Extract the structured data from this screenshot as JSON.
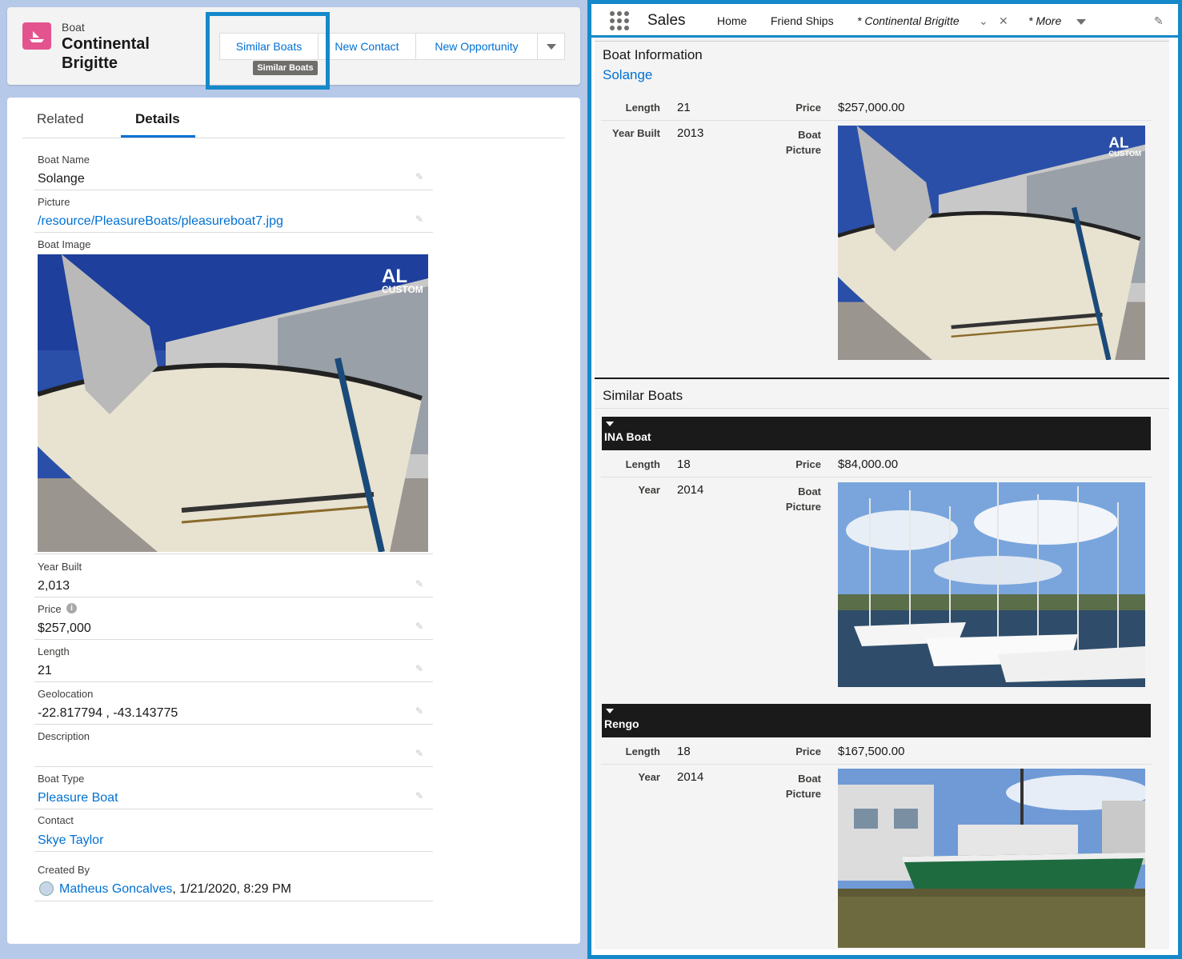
{
  "header": {
    "object_type": "Boat",
    "record_title": "Continental Brigitte",
    "actions": [
      "Similar Boats",
      "New Contact",
      "New Opportunity"
    ],
    "tooltip": "Similar Boats"
  },
  "tabs": [
    "Related",
    "Details"
  ],
  "fields": {
    "boat_name_label": "Boat Name",
    "boat_name": "Solange",
    "picture_label": "Picture",
    "picture": "/resource/PleasureBoats/pleasureboat7.jpg",
    "boat_image_label": "Boat Image",
    "year_built_label": "Year Built",
    "year_built": "2,013",
    "price_label": "Price",
    "price": "$257,000",
    "length_label": "Length",
    "length": "21",
    "geolocation_label": "Geolocation",
    "geolocation": "-22.817794 , -43.143775",
    "description_label": "Description",
    "description": "",
    "boat_type_label": "Boat Type",
    "boat_type": "Pleasure Boat",
    "contact_label": "Contact",
    "contact": "Skye Taylor",
    "created_by_label": "Created By",
    "created_by_user": "Matheus Goncalves",
    "created_by_date": ", 1/21/2020, 8:29 PM"
  },
  "nav": {
    "app_name": "Sales",
    "items": [
      "Home",
      "Friend Ships",
      "* Continental Brigitte",
      "* More"
    ]
  },
  "boat_info": {
    "heading": "Boat Information",
    "name": "Solange",
    "length_label": "Length",
    "length": "21",
    "price_label": "Price",
    "price": "$257,000.00",
    "year_label": "Year Built",
    "year": "2013",
    "picture_label": "Boat Picture"
  },
  "similar": {
    "heading": "Similar Boats",
    "boats": [
      {
        "name": "INA Boat",
        "length_label": "Length",
        "length": "18",
        "price_label": "Price",
        "price": "$84,000.00",
        "year_label": "Year",
        "year": "2014",
        "picture_label": "Boat Picture"
      },
      {
        "name": "Rengo",
        "length_label": "Length",
        "length": "18",
        "price_label": "Price",
        "price": "$167,500.00",
        "year_label": "Year",
        "year": "2014",
        "picture_label": "Boat Picture"
      }
    ]
  },
  "colors": {
    "brand_blue": "#0070d2",
    "highlight": "#1589c9",
    "boat_icon": "#e3548f"
  }
}
